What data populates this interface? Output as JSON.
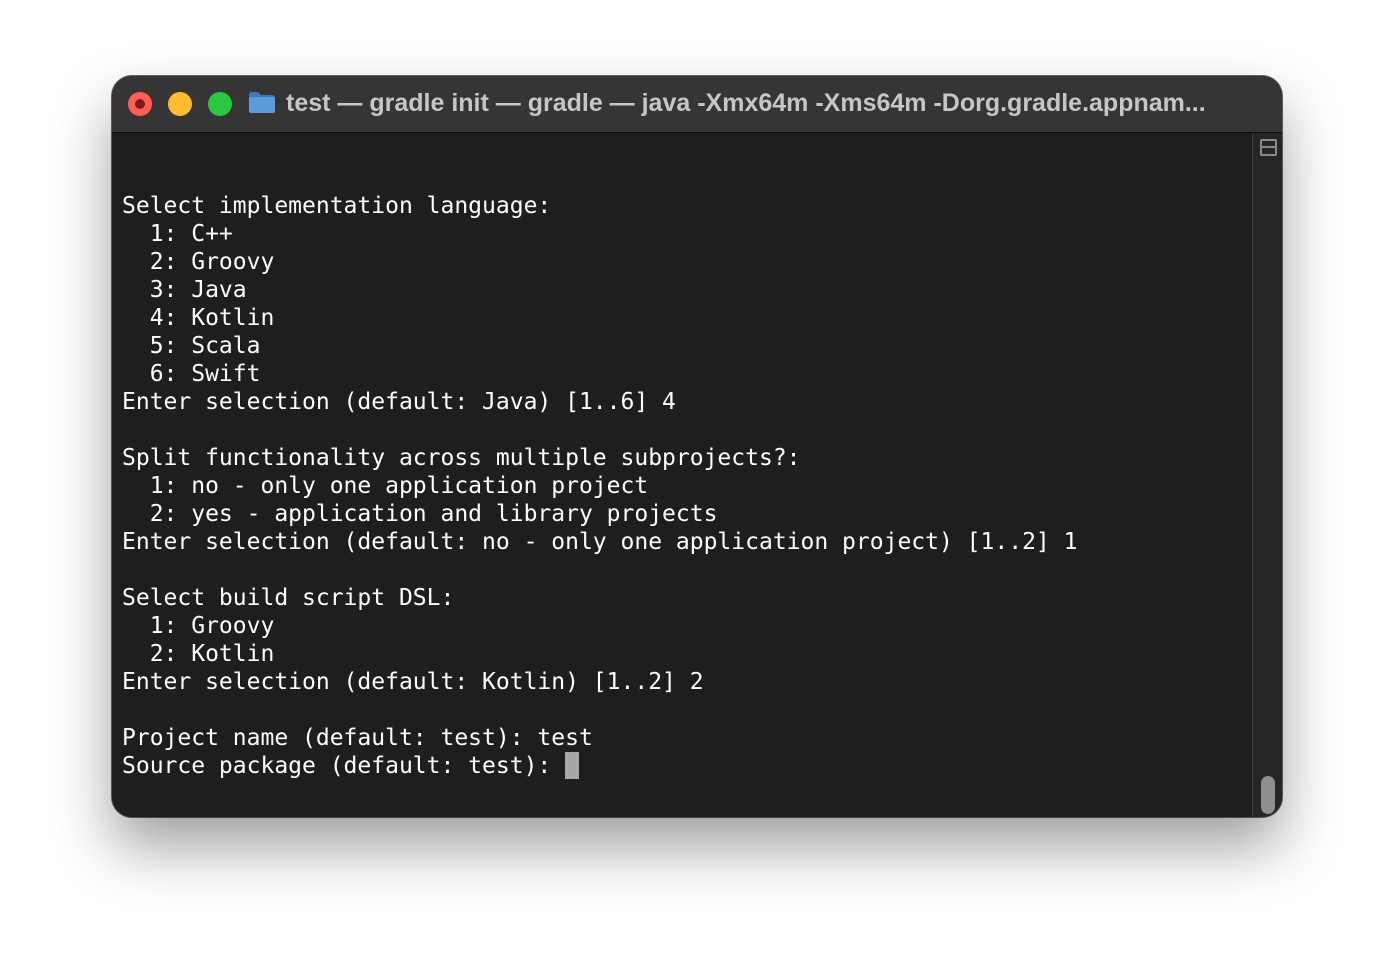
{
  "window": {
    "title": "test — gradle init — gradle — java -Xmx64m -Xms64m -Dorg.gradle.appnam..."
  },
  "titlebar": {
    "icons": [
      "close-icon",
      "minimize-icon",
      "zoom-icon",
      "folder-icon"
    ]
  },
  "terminal": {
    "lines": [
      "",
      "Select implementation language:",
      "  1: C++",
      "  2: Groovy",
      "  3: Java",
      "  4: Kotlin",
      "  5: Scala",
      "  6: Swift",
      "Enter selection (default: Java) [1..6] 4",
      "",
      "Split functionality across multiple subprojects?:",
      "  1: no - only one application project",
      "  2: yes - application and library projects",
      "Enter selection (default: no - only one application project) [1..2] 1",
      "",
      "Select build script DSL:",
      "  1: Groovy",
      "  2: Kotlin",
      "Enter selection (default: Kotlin) [1..2] 2",
      "",
      "Project name (default: test): test"
    ],
    "prompt": "Source package (default: test): "
  },
  "scrollbar": {
    "icon": "split-pane-icon"
  },
  "colors": {
    "background": "#1e1e1e",
    "titlebar": "#353535",
    "text": "#ffffff",
    "title_text": "#c6c6c6",
    "close": "#ff5f57",
    "minimize": "#febc2e",
    "zoom": "#28c840",
    "folder": "#4f8fd0",
    "cursor": "#a7a7a7"
  }
}
